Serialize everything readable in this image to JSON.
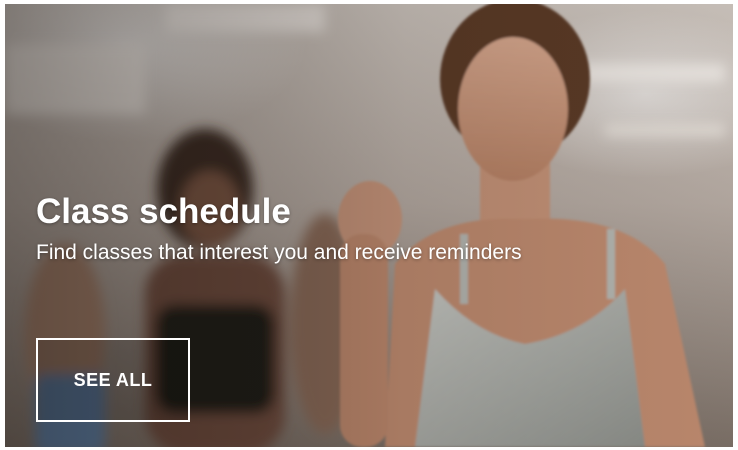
{
  "card": {
    "title": "Class schedule",
    "subtitle": "Find classes that interest you and receive reminders",
    "button_label": "SEE ALL",
    "background_image": "fitness-class-photo"
  },
  "colors": {
    "text": "#ffffff",
    "button_border": "#ffffff"
  }
}
